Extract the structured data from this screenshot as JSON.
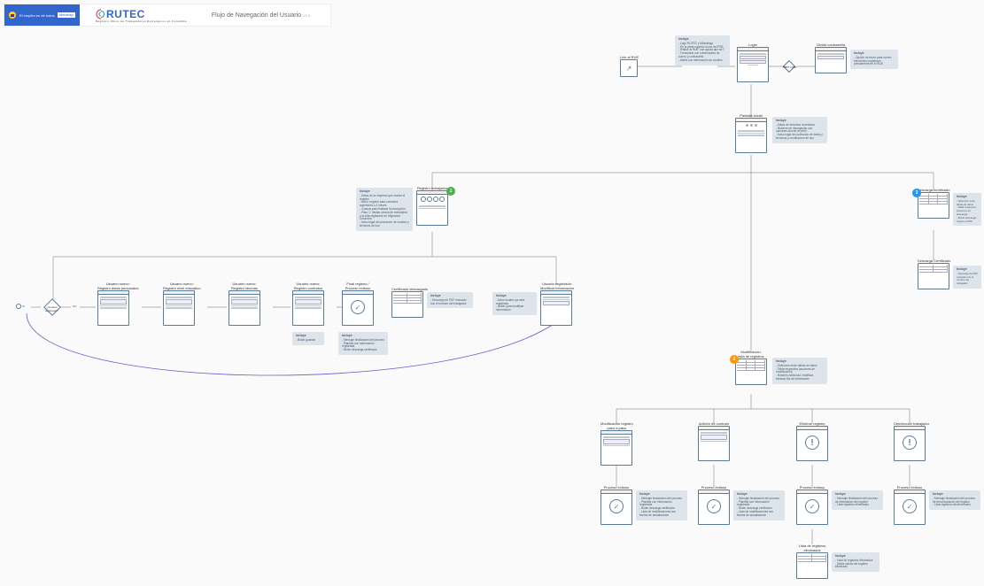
{
  "header": {
    "gov_text": "El empleo es de todos",
    "gov_sub": "Mintrabajo",
    "logo_text": "RUTEC",
    "logo_sub": "Registro Único de Trabajadores Extranjeros en Colombia",
    "title": "Flujo de Navegación del Usuario",
    "version": "V1.0"
  },
  "nodes": {
    "login": {
      "title": "Login"
    },
    "login_note": {
      "title": "Incluye",
      "body": "- Logo RUTEC y Mintrabajo\n- En la parte superior icono del PSE\n- Enlace al RUE 'con ayuda que se?'\n- Formulario con credenciales de correo y contraseña\n- Alerta con información de cookies"
    },
    "datos_login": {
      "label": "Datos Login"
    },
    "olvido": {
      "title": "Olvidó contraseña"
    },
    "olvido_note": {
      "title": "Incluye",
      "body": "- Opción de envío para correo electrónico registrado previamente en el RUE"
    },
    "link_rue": {
      "title": "Link al RUE"
    },
    "pantalla_inicial": {
      "title": "Pantalla inicial"
    },
    "pantalla_note": {
      "title": "Incluye",
      "body": "- Datos de empresa conectada\n- Botones de navegación con opciones acorde al perfil\n- Aviso legal de protección de datos y términos y condiciones de uso"
    },
    "registro_trabajador": {
      "title": "Registro trabajador"
    },
    "registro_note": {
      "title": "Incluye",
      "body": "- Datos de la empresa que realiza el registro\n- Aviso: registro para contratos superiores a 3 meses\n- 4 pasos para finalizar la inscripción\n- Paso 1. Validar cédula de extranjería y si está registrado en Migración Colombia\n- Aviso legal de protección de cookies y términos de uso"
    },
    "decision": {
      "label": "¿Usuario registrado?",
      "si": "SI",
      "no": "NO"
    },
    "nuevo_datos": {
      "title": "Usuario nuevo:\nRegistro datos personales"
    },
    "nuevo_nivel": {
      "title": "Usuario nuevo:\nRegistro nivel educativo"
    },
    "nuevo_idiomas": {
      "title": "Usuario nuevo:\nRegistro idiomas"
    },
    "nuevo_contratos": {
      "title": "Usuario nuevo:\nRegistro contratos"
    },
    "nuevo_contratos_note": {
      "title": "Incluye",
      "body": "- Botón guardar"
    },
    "final_registro": {
      "title": "Final registro /\nProceso exitoso"
    },
    "final_note": {
      "title": "Incluye",
      "body": "- Mensaje finalización del proceso\n- Plantilla con información registrada\n- Botón descarga certificado"
    },
    "cert_descargado": {
      "title": "Certificado descargado"
    },
    "cert_note": {
      "title": "Incluye",
      "body": "- Descarga de PDF marcado con el nombre del trabajador"
    },
    "usuario_registrado": {
      "title": "Usuario registrado:\nModificar información"
    },
    "usuario_reg_note": {
      "title": "Incluye",
      "body": "- Aviso usuario ya está registrado\n- Botón para modificar información"
    },
    "modificacion": {
      "title": "Modificación:\nlista de registros"
    },
    "modificacion_note": {
      "title": "Incluye",
      "body": "- Selección entre tablas de datos\n- Tabla respectiva (acciones de modificación)\n- Botones Adicionar, modificar, eliminar fila de información"
    },
    "descarga_cert": {
      "title": "Descarga certificado"
    },
    "descarga_note": {
      "title": "Incluye",
      "body": "- Selección entre tablas de datos\n- Tabla respectiva (acciones de descarga)\n- Botón descargar registro a PDF"
    },
    "descarga_cert2": {
      "title": "Descarga Certificado"
    },
    "descarga_cert2_note": {
      "title": "Incluye",
      "body": "- Descarga de PDF marcado con el nombre del trabajador"
    },
    "mod_paso": {
      "title": "Modificación registro\npaso a paso"
    },
    "adicion": {
      "title": "Adición de contrato"
    },
    "eliminar": {
      "title": "Eliminar registro"
    },
    "desvincular": {
      "title": "Desvincular trabajador"
    },
    "proc_exitoso": {
      "title": "Proceso éxitoso"
    },
    "proc_exitoso_note1": {
      "title": "Incluye",
      "body": "- Mensaje finalización del proceso\n- Plantilla con información registrada\n- Botón descarga certificado\n- Lista de modificaciones con fechas de actualización"
    },
    "proc_exitoso_note2": {
      "title": "Incluye",
      "body": "- Mensaje finalización del proceso\n- Plantilla con información registrada\n- Botón descarga certificado\n- Lista de modificaciones con fechas de actualización"
    },
    "proc_exitoso_note3": {
      "title": "Incluye",
      "body": "- Mensaje finalización del proceso de eliminación del registro\n- Lista registros eliminados"
    },
    "proc_exitoso_note4": {
      "title": "Incluye",
      "body": "- Mensaje finalización del proceso de desvinculación del registro\n- Lista registros desvinculados"
    },
    "lista_eliminados": {
      "title": "Lista de registros\neliminados"
    },
    "lista_note": {
      "title": "Incluye",
      "body": "- Lista de registros eliminados\n- Datos claves del registro eliminado"
    }
  }
}
